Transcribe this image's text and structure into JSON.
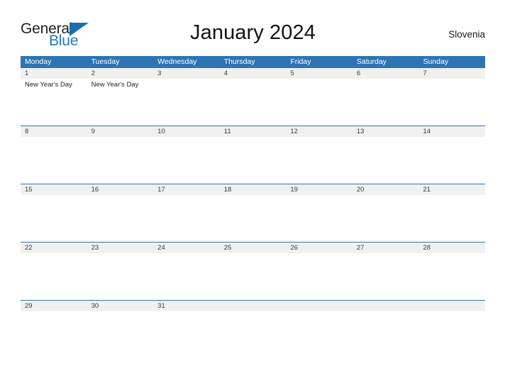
{
  "brand": {
    "logo_text_top": "General",
    "logo_text_bottom": "Blue",
    "accent_color": "#1b6cb0",
    "logo_icon": "triangle-pennant-icon"
  },
  "header": {
    "title": "January 2024",
    "country": "Slovenia"
  },
  "theme": {
    "header_blue": "#2e74b5",
    "date_band_gray": "#f0f0f0",
    "text_dark": "#222222",
    "text_white": "#ffffff"
  },
  "calendar": {
    "month": "January",
    "year": "2024",
    "weekday_headers": [
      "Monday",
      "Tuesday",
      "Wednesday",
      "Thursday",
      "Friday",
      "Saturday",
      "Sunday"
    ],
    "weeks": [
      {
        "days": [
          {
            "date": "1",
            "event": "New Year's Day"
          },
          {
            "date": "2",
            "event": "New Year's Day"
          },
          {
            "date": "3",
            "event": ""
          },
          {
            "date": "4",
            "event": ""
          },
          {
            "date": "5",
            "event": ""
          },
          {
            "date": "6",
            "event": ""
          },
          {
            "date": "7",
            "event": ""
          }
        ]
      },
      {
        "days": [
          {
            "date": "8",
            "event": ""
          },
          {
            "date": "9",
            "event": ""
          },
          {
            "date": "10",
            "event": ""
          },
          {
            "date": "11",
            "event": ""
          },
          {
            "date": "12",
            "event": ""
          },
          {
            "date": "13",
            "event": ""
          },
          {
            "date": "14",
            "event": ""
          }
        ]
      },
      {
        "days": [
          {
            "date": "15",
            "event": ""
          },
          {
            "date": "16",
            "event": ""
          },
          {
            "date": "17",
            "event": ""
          },
          {
            "date": "18",
            "event": ""
          },
          {
            "date": "19",
            "event": ""
          },
          {
            "date": "20",
            "event": ""
          },
          {
            "date": "21",
            "event": ""
          }
        ]
      },
      {
        "days": [
          {
            "date": "22",
            "event": ""
          },
          {
            "date": "23",
            "event": ""
          },
          {
            "date": "24",
            "event": ""
          },
          {
            "date": "25",
            "event": ""
          },
          {
            "date": "26",
            "event": ""
          },
          {
            "date": "27",
            "event": ""
          },
          {
            "date": "28",
            "event": ""
          }
        ]
      },
      {
        "days": [
          {
            "date": "29",
            "event": ""
          },
          {
            "date": "30",
            "event": ""
          },
          {
            "date": "31",
            "event": ""
          },
          {
            "date": "",
            "event": ""
          },
          {
            "date": "",
            "event": ""
          },
          {
            "date": "",
            "event": ""
          },
          {
            "date": "",
            "event": ""
          }
        ]
      }
    ]
  }
}
